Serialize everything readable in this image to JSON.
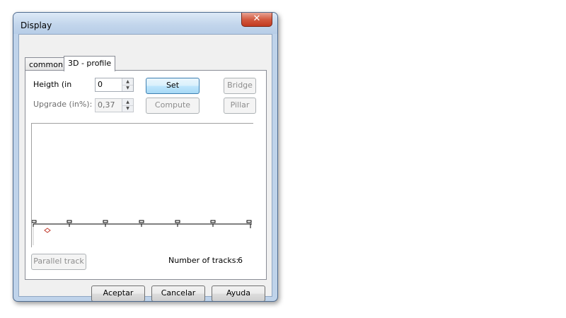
{
  "window": {
    "title": "Display",
    "close_label": "✕"
  },
  "tabs": [
    {
      "label": "common"
    },
    {
      "label": "3D - profile"
    }
  ],
  "form": {
    "height_label": "Heigth (in",
    "height_value": "0",
    "upgrade_label": "Upgrade (in%):",
    "upgrade_value": "0,37",
    "set_label": "Set",
    "compute_label": "Compute",
    "bridge_label": "Bridge",
    "pillar_label": "Pillar"
  },
  "profile": {
    "parallel_track_label": "Parallel track",
    "tracks_label": "Number of tracks:",
    "tracks_value": "6"
  },
  "footer": {
    "ok_label": "Aceptar",
    "cancel_label": "Cancelar",
    "help_label": "Ayuda"
  },
  "colors": {
    "marker": "#c0392b",
    "window_frame": "#bfd3ea",
    "default_button": "#a7d9f5"
  },
  "icons": {
    "spin_up": "▲",
    "spin_down": "▼"
  }
}
